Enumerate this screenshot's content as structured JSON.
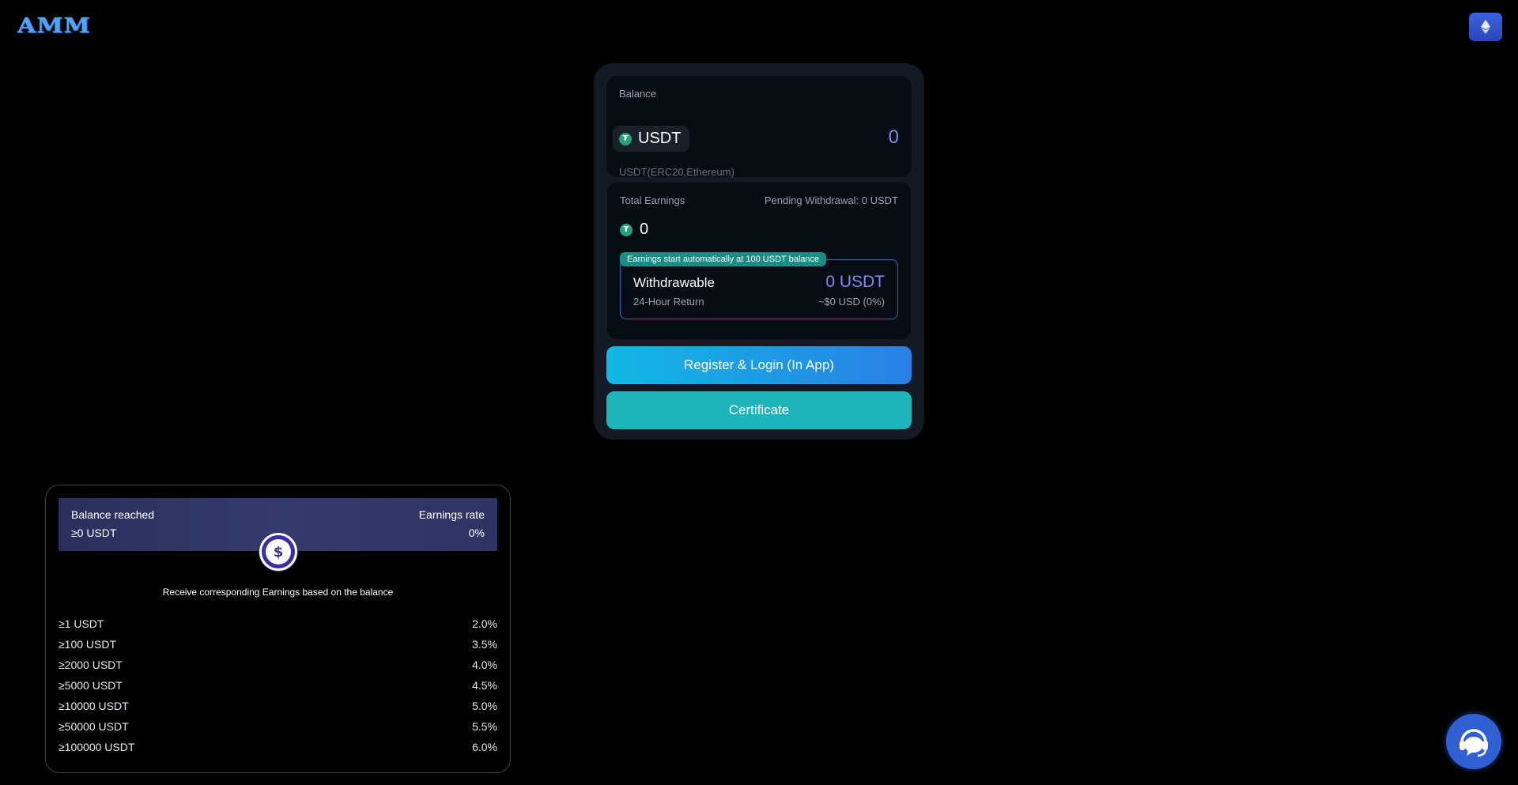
{
  "header": {
    "logo_text": "AMM",
    "network_icon": "ethereum-icon",
    "brand_color": "#3b63e0"
  },
  "balance": {
    "label": "Balance",
    "token": "USDT",
    "token_icon": "tether-icon",
    "value": "0",
    "network": "USDT(ERC20,Ethereum)"
  },
  "earnings": {
    "label": "Total Earnings",
    "pending": "Pending Withdrawal: 0 USDT",
    "value": "0",
    "notice": "Earnings start automatically at 100 USDT balance",
    "withdrawable_label": "Withdrawable",
    "withdrawable_value": "0 USDT",
    "return_label": "24-Hour Return",
    "return_value": "~$0 USD (0%)"
  },
  "actions": {
    "register_label": "Register & Login (In App)",
    "certificate_label": "Certificate"
  },
  "tiers": {
    "balance_reached_label": "Balance reached",
    "balance_reached_value": "≥0 USDT",
    "rate_label": "Earnings rate",
    "rate_value": "0%",
    "caption": "Receive corresponding Earnings based on the balance",
    "rows": [
      {
        "threshold": "≥1 USDT",
        "rate": "2.0%"
      },
      {
        "threshold": "≥100 USDT",
        "rate": "3.5%"
      },
      {
        "threshold": "≥2000 USDT",
        "rate": "4.0%"
      },
      {
        "threshold": "≥5000 USDT",
        "rate": "4.5%"
      },
      {
        "threshold": "≥10000 USDT",
        "rate": "5.0%"
      },
      {
        "threshold": "≥50000 USDT",
        "rate": "5.5%"
      },
      {
        "threshold": "≥100000 USDT",
        "rate": "6.0%"
      }
    ]
  },
  "support": {
    "icon": "customer-support-icon"
  }
}
